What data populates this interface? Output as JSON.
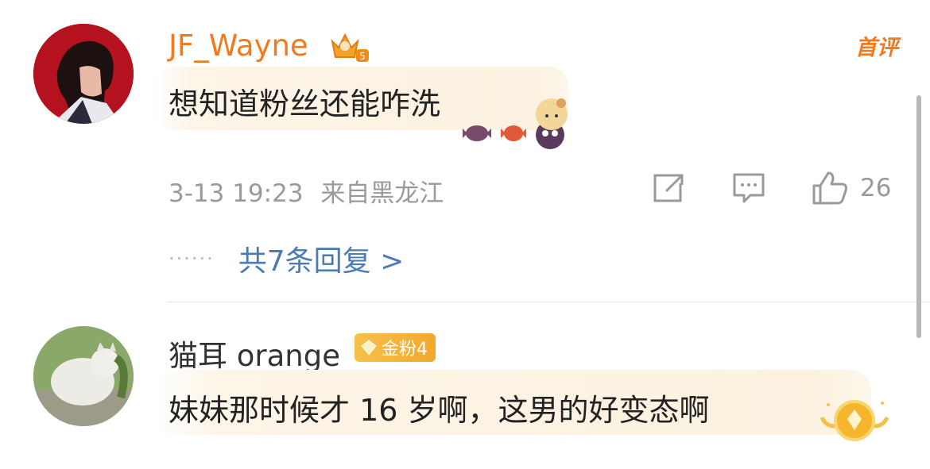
{
  "comments": [
    {
      "username": "JF_Wayne",
      "tag": "首评",
      "content": "想知道粉丝还能咋洗",
      "time": "3-13 19:23",
      "location": "来自黑龙江",
      "likes": "26",
      "replies_label": "共7条回复 >",
      "replies_dots": "······",
      "badge_icon": "crown-level-badge",
      "name_color": "#f07a1e"
    },
    {
      "username": "猫耳 orange",
      "badge_label": "金粉4",
      "content": "妹妹那时候才 16 岁啊，这男的好变态啊",
      "name_color": "#333333"
    }
  ],
  "icons": [
    "share-icon",
    "comment-icon",
    "like-icon"
  ],
  "colors": {
    "accent_orange": "#f07a1e",
    "link_blue": "#4a7bb5",
    "meta_gray": "#9a9a9a"
  }
}
